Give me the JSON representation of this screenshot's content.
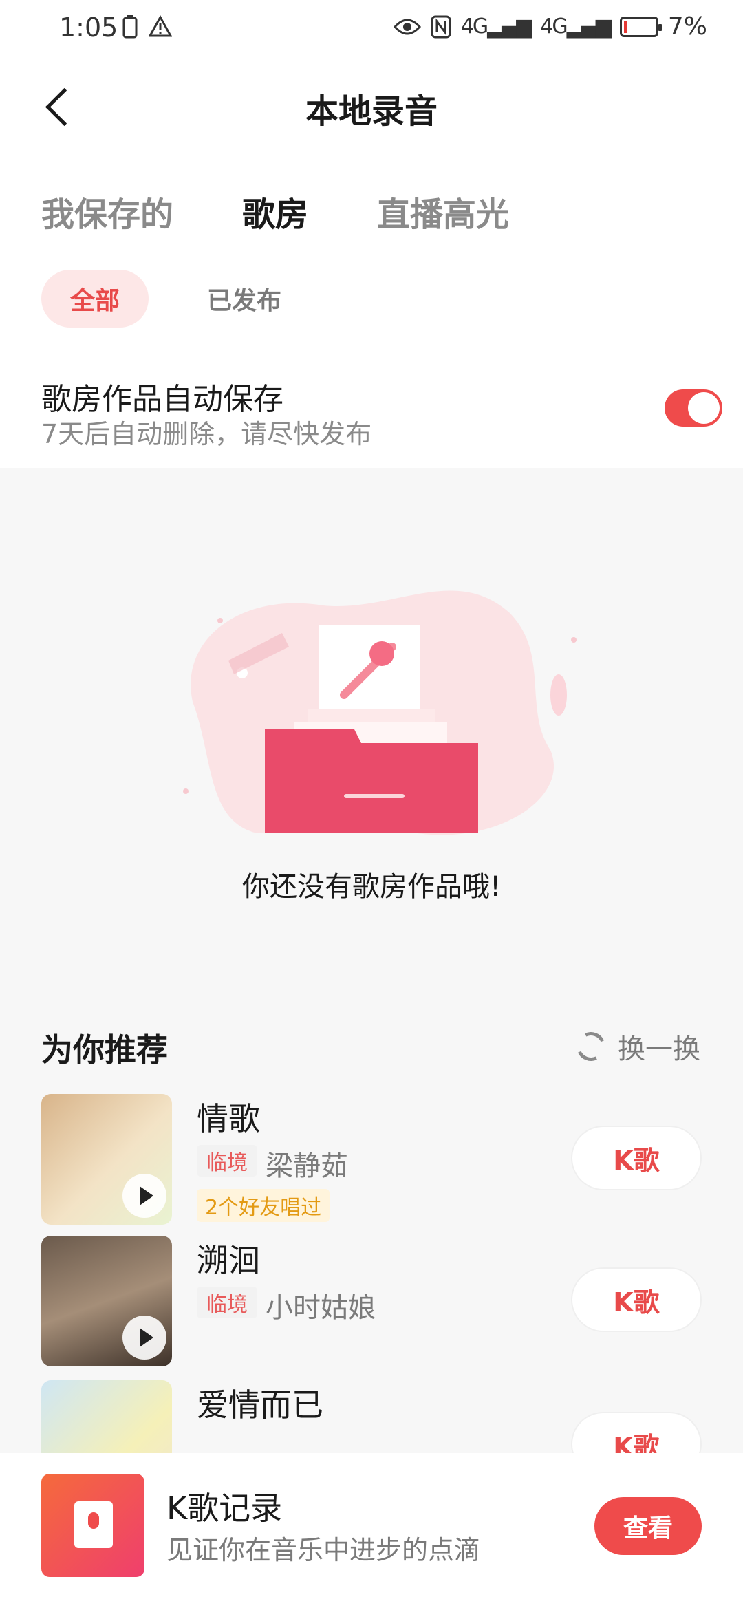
{
  "status_bar": {
    "time": "1:05",
    "battery": "7%",
    "signal_label": "4G"
  },
  "header": {
    "title": "本地录音"
  },
  "tabs": [
    {
      "label": "我保存的"
    },
    {
      "label": "歌房"
    },
    {
      "label": "直播高光"
    }
  ],
  "filters": {
    "all": "全部",
    "published": "已发布"
  },
  "auto_save": {
    "title": "歌房作品自动保存",
    "subtitle": "7天后自动删除，请尽快发布",
    "enabled": true
  },
  "empty_state": {
    "message": "你还没有歌房作品哦!"
  },
  "recommend": {
    "title": "为你推荐",
    "refresh_label": "换一换",
    "songs": [
      {
        "name": "情歌",
        "badge": "临境",
        "artist": "梁静茹",
        "friends": "2个好友唱过",
        "button": "K歌"
      },
      {
        "name": "溯洄",
        "badge": "临境",
        "artist": "小时姑娘",
        "button": "K歌"
      },
      {
        "name": "爱情而已",
        "button": "K歌"
      }
    ]
  },
  "banner": {
    "title": "K歌记录",
    "subtitle": "见证你在音乐中进步的点滴",
    "button": "查看"
  },
  "colors": {
    "accent": "#ef4b4b",
    "pill_bg": "#fde7e7"
  }
}
